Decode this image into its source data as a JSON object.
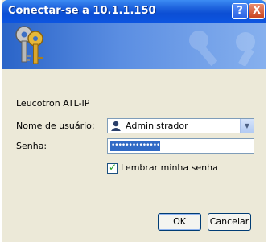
{
  "window": {
    "title": "Conectar-se a 10.1.1.150"
  },
  "titlebar_buttons": {
    "help": "?",
    "close": "X"
  },
  "dialog": {
    "realm": "Leucotron ATL-IP",
    "username_label": "Nome de usuário:",
    "username_value": "Administrador",
    "password_label": "Senha:",
    "password_value": "••••••••••••••",
    "remember_label": "Lembrar minha senha",
    "remember_checked": true,
    "ok_label": "OK",
    "cancel_label": "Cancelar"
  },
  "colors": {
    "title_bar": "#0b4ed4",
    "banner": "#5b8ee2",
    "dialog_bg": "#ece9d8",
    "selection": "#316ac5"
  },
  "icons": {
    "banner": "keys-icon",
    "user": "user-icon",
    "dropdown": "chevron-down-icon",
    "check": "checkmark-icon"
  }
}
